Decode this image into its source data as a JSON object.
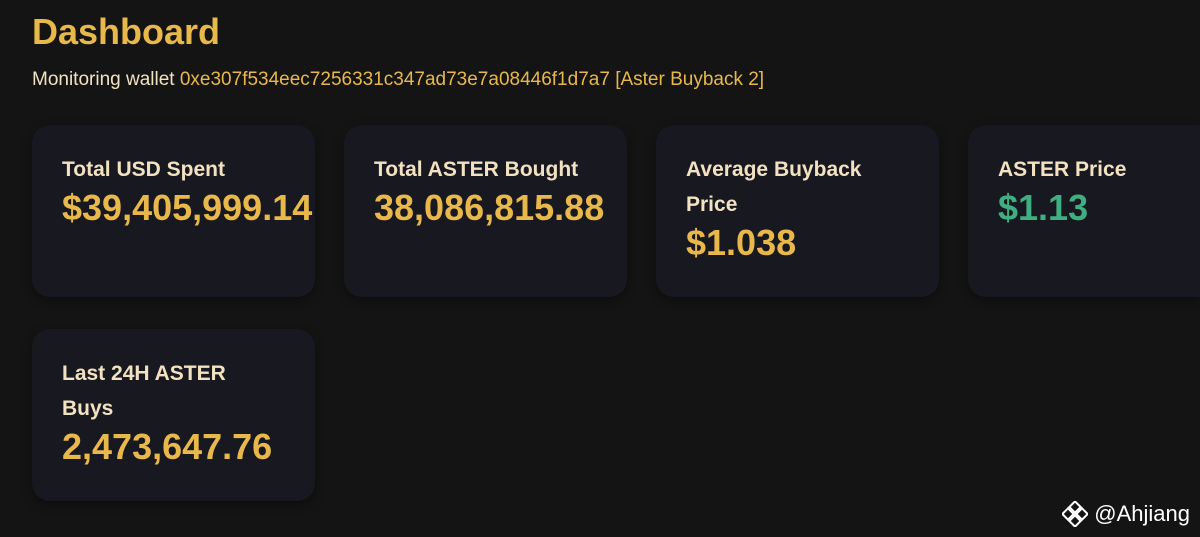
{
  "colors": {
    "background": "#141414",
    "card_background": "#181820",
    "accent_gold": "#E8B84A",
    "label_cream": "#F3E2C2",
    "price_green": "#3FAE80",
    "watermark_white": "#FFFFFF"
  },
  "header": {
    "title": "Dashboard",
    "subtitle_prefix": "Monitoring wallet",
    "wallet_address": "0xe307f534eec7256331c347ad73e7a08446f1d7a7",
    "wallet_tag": "[Aster Buyback 2]"
  },
  "cards": [
    {
      "label": "Total USD Spent",
      "value": "$39,405,999.14"
    },
    {
      "label": "Total ASTER Bought",
      "value": "38,086,815.88"
    },
    {
      "label": "Average Buyback Price",
      "value": "$1.038"
    },
    {
      "label": "ASTER Price",
      "value": "$1.13"
    },
    {
      "label": "Last 24H ASTER Buys",
      "value": "2,473,647.76"
    }
  ],
  "watermark": {
    "icon": "binance-square-icon",
    "handle": "@Ahjiang"
  }
}
